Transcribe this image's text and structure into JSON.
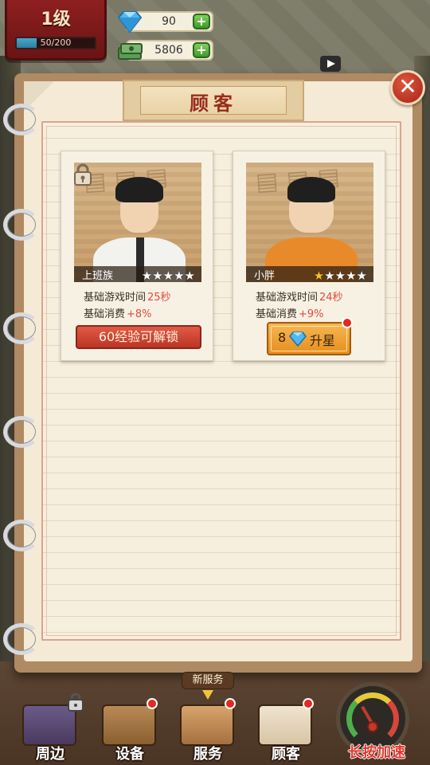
{
  "hud": {
    "level": "1级",
    "xp_text": "50/200",
    "xp_progress": 0.25,
    "gems": "90",
    "cash": "5806",
    "gem_icon": "diamond-icon",
    "cash_icon": "cash-stack-icon",
    "plus_label": "+"
  },
  "panel": {
    "title": "顾客",
    "close_label": "✕",
    "customers": [
      {
        "name": "上班族",
        "stars_filled": 0,
        "stars_total": 5,
        "locked": true,
        "play_time_label": "基础游戏时间",
        "play_time_value": "25秒",
        "spend_label": "基础消费",
        "spend_value": "+8%",
        "action_label": "60经验可解锁"
      },
      {
        "name": "小胖",
        "stars_filled": 1,
        "stars_total": 5,
        "locked": false,
        "play_time_label": "基础游戏时间",
        "play_time_value": "24秒",
        "spend_label": "基础消费",
        "spend_value": "+9%",
        "upgrade_cost": "8",
        "upgrade_label": "升星",
        "has_notification": true
      }
    ]
  },
  "bottom_nav": {
    "new_service_tag": "新服务",
    "items": [
      {
        "label": "周边",
        "locked": true,
        "notification": false
      },
      {
        "label": "设备",
        "locked": false,
        "notification": true
      },
      {
        "label": "服务",
        "locked": false,
        "notification": true
      },
      {
        "label": "顾客",
        "locked": false,
        "notification": true
      }
    ],
    "speed_label": "长按加速"
  },
  "colors": {
    "accent_red": "#e24a3a",
    "star_on": "#f6c325",
    "plus_green": "#3f9a2a"
  }
}
